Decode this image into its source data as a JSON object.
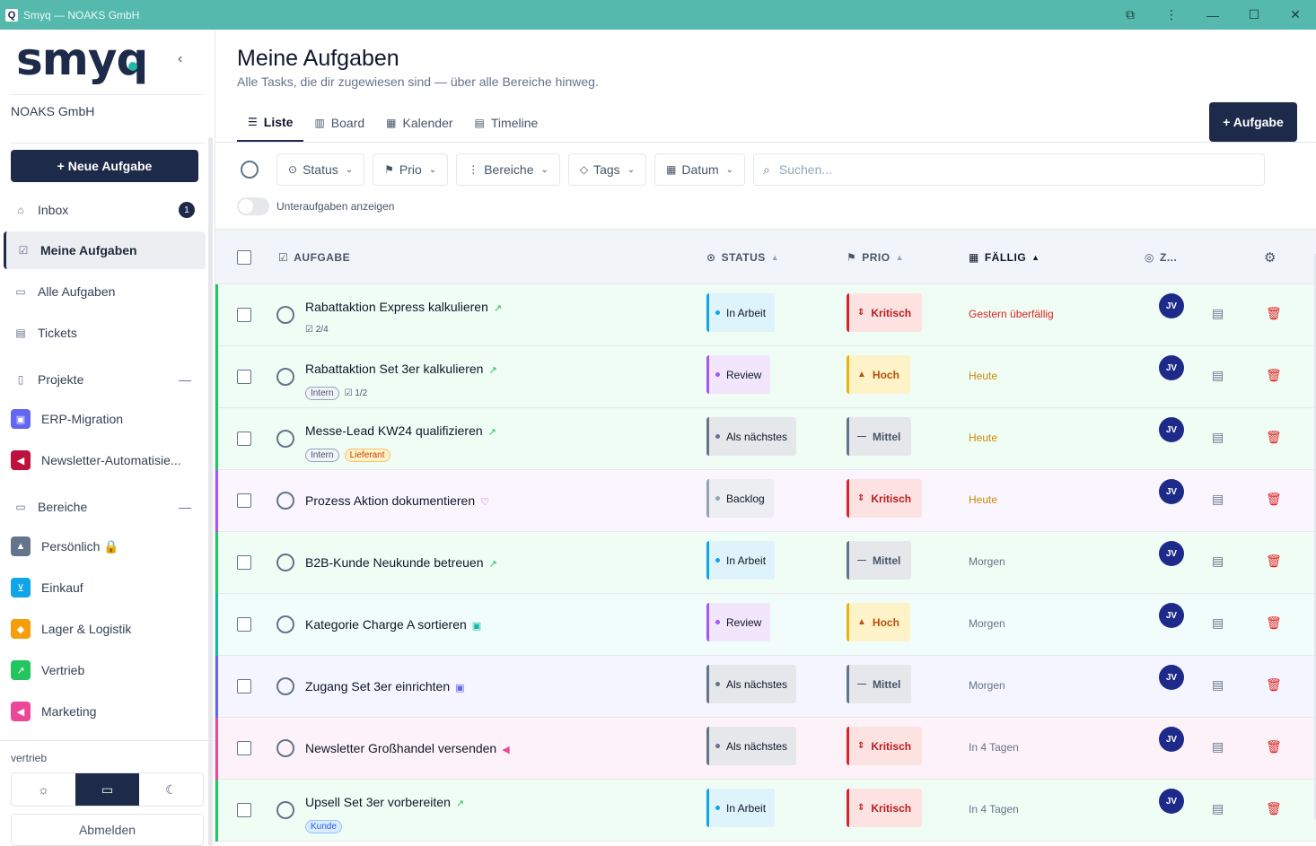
{
  "window": {
    "title": "Smyq — NOAKS GmbH",
    "logo_letter": "Q",
    "controls": [
      "⧉",
      "⋮",
      "—",
      "☐",
      "✕"
    ]
  },
  "sidebar": {
    "logo": "smyq",
    "collapse": "‹",
    "org": "NOAKS GmbH",
    "new_task": "+  Neue Aufgabe",
    "nav": [
      {
        "label": "Inbox",
        "icon": "inbox-icon",
        "glyph": "⌂",
        "badge": "1"
      },
      {
        "label": "Meine Aufgaben",
        "icon": "check-square-icon",
        "glyph": "☑"
      },
      {
        "label": "Alle Aufgaben",
        "icon": "folder-icon",
        "glyph": "▭"
      },
      {
        "label": "Tickets",
        "icon": "ticket-icon",
        "glyph": "▤"
      }
    ],
    "projects_header": "Projekte",
    "areas_header": "Bereiche",
    "collapse_glyph": "—",
    "projects": [
      {
        "label": "ERP-Migration",
        "color": "#6366f1",
        "glyph": "▣"
      },
      {
        "label": "Newsletter-Automatisie...",
        "color": "#be123c",
        "glyph": "◀"
      }
    ],
    "areas": [
      {
        "label": "Persönlich 🔒",
        "color": "#64748b",
        "glyph": "▲"
      },
      {
        "label": "Einkauf",
        "color": "#0ea5e9",
        "glyph": "⊻"
      },
      {
        "label": "Lager & Logistik",
        "color": "#f59e0b",
        "glyph": "◆"
      },
      {
        "label": "Vertrieb",
        "color": "#22c55e",
        "glyph": "↗"
      },
      {
        "label": "Marketing",
        "color": "#ec4899",
        "glyph": "◀"
      }
    ],
    "workspace": "vertrieb",
    "theme": [
      "☼",
      "▭",
      "☾"
    ],
    "logout": "Abmelden"
  },
  "main": {
    "title": "Meine Aufgaben",
    "subtitle": "Alle Tasks, die dir zugewiesen sind — über alle Bereiche hinweg.",
    "tabs": [
      {
        "label": "Liste",
        "glyph": "☰"
      },
      {
        "label": "Board",
        "glyph": "▥"
      },
      {
        "label": "Kalender",
        "glyph": "▦"
      },
      {
        "label": "Timeline",
        "glyph": "▤"
      }
    ],
    "add_task": "+ Aufgabe",
    "filters": [
      {
        "label": "Status",
        "glyph": "⊙"
      },
      {
        "label": "Prio",
        "glyph": "⚑"
      },
      {
        "label": "Bereiche",
        "glyph": "⋮"
      },
      {
        "label": "Tags",
        "glyph": "◇"
      },
      {
        "label": "Datum",
        "glyph": "▦"
      }
    ],
    "search_placeholder": "Suchen...",
    "subtasks_toggle": "Unteraufgaben anzeigen",
    "columns": {
      "task": "AUFGABE",
      "status": "STATUS",
      "prio": "PRIO",
      "due": "FÄLLIG",
      "assignee": "Z..."
    }
  },
  "colors": {
    "in_arbeit": "#0ea5e9",
    "review": "#a855f7",
    "als_naechstes": "#64748b",
    "backlog": "#94a3b8",
    "kritisch": "#dc2626",
    "hoch": "#eab308",
    "mittel": "#64748b"
  },
  "tasks": [
    {
      "title": "Rabattaktion Express kalkulieren",
      "icon": "↗",
      "icon_color": "#22c55e",
      "subtasks": "2/4",
      "tags": [],
      "status": "In Arbeit",
      "prio": "Kritisch",
      "due": "Gestern überfällig",
      "due_color": "#dc2626",
      "area_color": "#22c55e",
      "row_bg": "#f0fdf4",
      "assignee": "JV"
    },
    {
      "title": "Rabattaktion Set 3er kalkulieren",
      "icon": "↗",
      "icon_color": "#22c55e",
      "subtasks": "1/2",
      "tags": [
        "Intern"
      ],
      "status": "Review",
      "prio": "Hoch",
      "due": "Heute",
      "due_color": "#ca8a04",
      "area_color": "#22c55e",
      "row_bg": "#f0fdf4",
      "assignee": "JV"
    },
    {
      "title": "Messe-Lead KW24 qualifizieren",
      "icon": "↗",
      "icon_color": "#22c55e",
      "subtasks": "",
      "tags": [
        "Intern",
        "Lieferant"
      ],
      "status": "Als nächstes",
      "prio": "Mittel",
      "due": "Heute",
      "due_color": "#ca8a04",
      "area_color": "#22c55e",
      "row_bg": "#f0fdf4",
      "assignee": "JV"
    },
    {
      "title": "Prozess Aktion dokumentieren",
      "icon": "♡",
      "icon_color": "#c026d3",
      "subtasks": "",
      "tags": [],
      "status": "Backlog",
      "prio": "Kritisch",
      "due": "Heute",
      "due_color": "#ca8a04",
      "area_color": "#a855f7",
      "row_bg": "#faf5ff",
      "assignee": "JV"
    },
    {
      "title": "B2B-Kunde Neukunde betreuen",
      "icon": "↗",
      "icon_color": "#22c55e",
      "subtasks": "",
      "tags": [],
      "status": "In Arbeit",
      "prio": "Mittel",
      "due": "Morgen",
      "due_color": "#64748b",
      "area_color": "#22c55e",
      "row_bg": "#f0fdf4",
      "assignee": "JV"
    },
    {
      "title": "Kategorie Charge A sortieren",
      "icon": "▣",
      "icon_color": "#14b8a6",
      "subtasks": "",
      "tags": [],
      "status": "Review",
      "prio": "Hoch",
      "due": "Morgen",
      "due_color": "#64748b",
      "area_color": "#14b8a6",
      "row_bg": "#f0fdfa",
      "assignee": "JV"
    },
    {
      "title": "Zugang Set 3er einrichten",
      "icon": "▣",
      "icon_color": "#6366f1",
      "subtasks": "",
      "tags": [],
      "status": "Als nächstes",
      "prio": "Mittel",
      "due": "Morgen",
      "due_color": "#64748b",
      "area_color": "#6366f1",
      "row_bg": "#f5f5ff",
      "assignee": "JV"
    },
    {
      "title": "Newsletter Großhandel versenden",
      "icon": "◀",
      "icon_color": "#ec4899",
      "subtasks": "",
      "tags": [],
      "status": "Als nächstes",
      "prio": "Kritisch",
      "due": "In 4 Tagen",
      "due_color": "#64748b",
      "area_color": "#ec4899",
      "row_bg": "#fdf2f8",
      "assignee": "JV"
    },
    {
      "title": "Upsell Set 3er vorbereiten",
      "icon": "↗",
      "icon_color": "#22c55e",
      "subtasks": "",
      "tags": [
        "Kunde"
      ],
      "status": "In Arbeit",
      "prio": "Kritisch",
      "due": "In 4 Tagen",
      "due_color": "#64748b",
      "area_color": "#22c55e",
      "row_bg": "#f0fdf4",
      "assignee": "JV"
    }
  ]
}
